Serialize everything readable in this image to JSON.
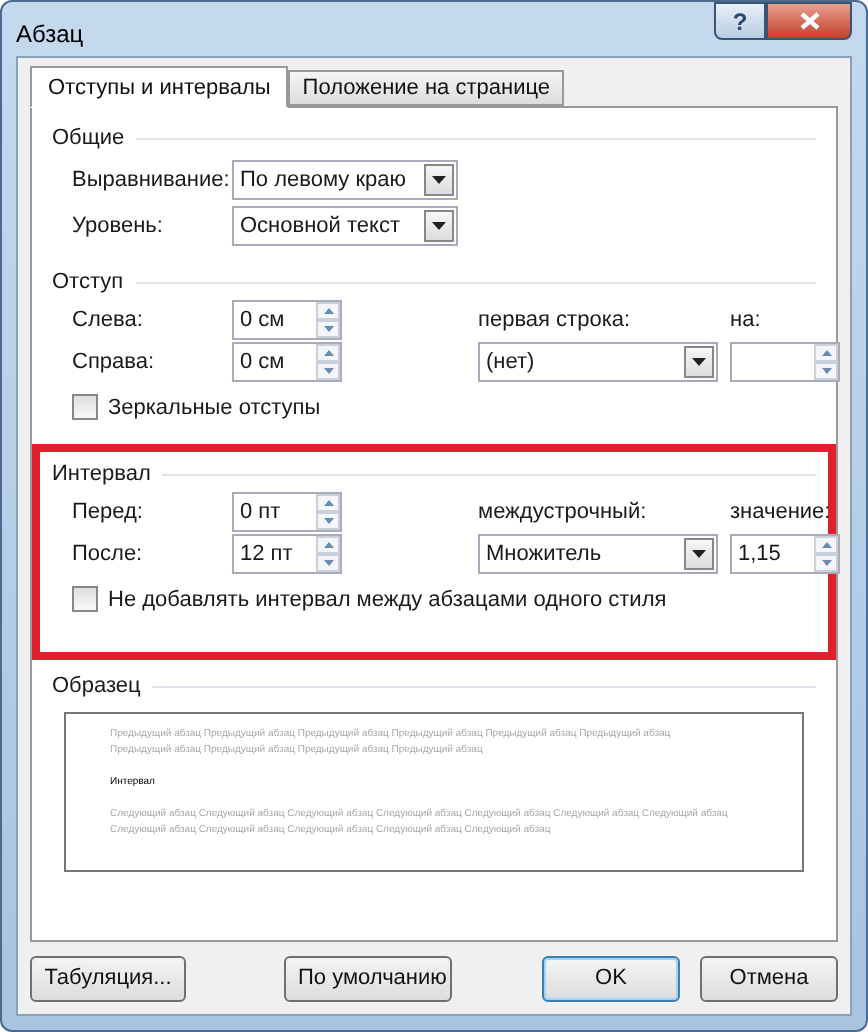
{
  "window": {
    "title": "Абзац",
    "help_button": "?"
  },
  "tabs": [
    {
      "label": "Отступы и интервалы",
      "selected": true
    },
    {
      "label": "Положение на странице",
      "selected": false
    }
  ],
  "general": {
    "title": "Общие",
    "rows": [
      {
        "label": "Выравнивание:",
        "value": "По левому краю"
      },
      {
        "label": "Уровень:",
        "value": "Основной текст"
      }
    ]
  },
  "sections": [
    {
      "title": "Отступ",
      "spinners": [
        {
          "label": "Слева:",
          "value": "0 см"
        },
        {
          "label": "Справа:",
          "value": "0 см"
        }
      ],
      "combo_label": "первая строка:",
      "combo_value": "(нет)",
      "amount_label": "на:",
      "checkbox": {
        "label": "Зеркальные отступы",
        "checked": false
      }
    },
    {
      "title": "Интервал",
      "highlighted": true,
      "spinners": [
        {
          "label": "Перед:",
          "value": "0 пт"
        },
        {
          "label": "После:",
          "value": "12 пт"
        }
      ],
      "combo_label": "междустрочный:",
      "combo_value": "Множитель",
      "amount_label": "значение:",
      "amount_value": "1,15",
      "checkbox": {
        "label": "Не добавлять интервал между абзацами одного стиля",
        "checked": false
      }
    }
  ],
  "preview": {
    "title": "Образец",
    "previous_text": "Предыдущий абзац Предыдущий абзац Предыдущий абзац Предыдущий абзац Предыдущий абзац Предыдущий абзац Предыдущий абзац Предыдущий абзац Предыдущий абзац Предыдущий абзац",
    "sample": "Интервал",
    "next_text": "Следующий абзац Следующий абзац Следующий абзац Следующий абзац Следующий абзац Следующий абзац Следующий абзац Следующий абзац Следующий абзац Следующий абзац Следующий абзац Следующий абзац"
  },
  "buttons": [
    {
      "label": "Табуляция...",
      "default": false
    },
    {
      "label": "По умолчанию",
      "default": false
    },
    {
      "label": "OK",
      "default": true
    },
    {
      "label": "Отмена",
      "default": false
    }
  ]
}
